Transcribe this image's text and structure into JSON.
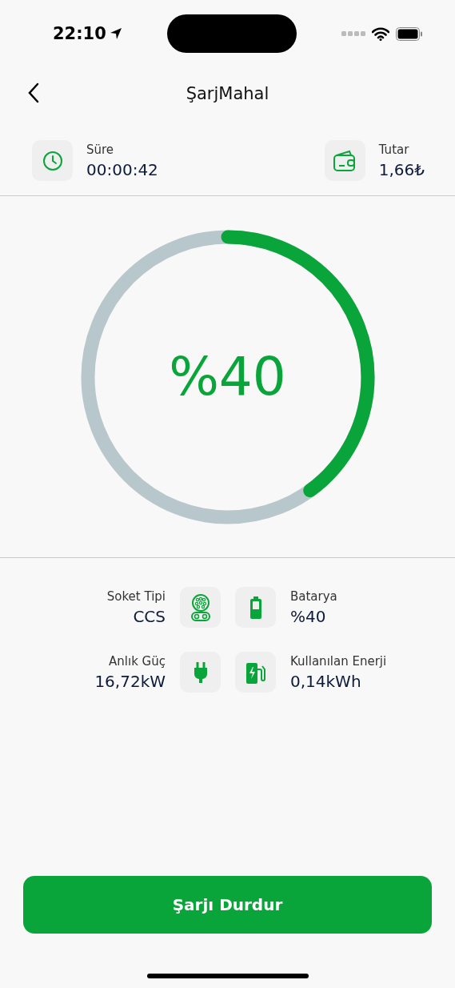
{
  "status_bar": {
    "time": "22:10"
  },
  "nav": {
    "title": "ŞarjMahal"
  },
  "summary": [
    {
      "kind": "time",
      "label": "Süre",
      "value": "00:00:42"
    },
    {
      "kind": "cost",
      "label": "Tutar",
      "value": "1,66₺"
    }
  ],
  "gauge": {
    "level": 0.4,
    "reading": "%40"
  },
  "stats": [
    {
      "kind": "socket",
      "label": "Soket Tipi",
      "value": "CCS"
    },
    {
      "kind": "battery",
      "label": "Batarya",
      "value": "%40"
    },
    {
      "kind": "power",
      "label": "Anlık Güç",
      "value": "16,72kW"
    },
    {
      "kind": "energy",
      "label": "Kullanılan Enerji",
      "value": "0,14kWh"
    }
  ],
  "primary_button": {
    "label": "Şarjı Durdur"
  }
}
